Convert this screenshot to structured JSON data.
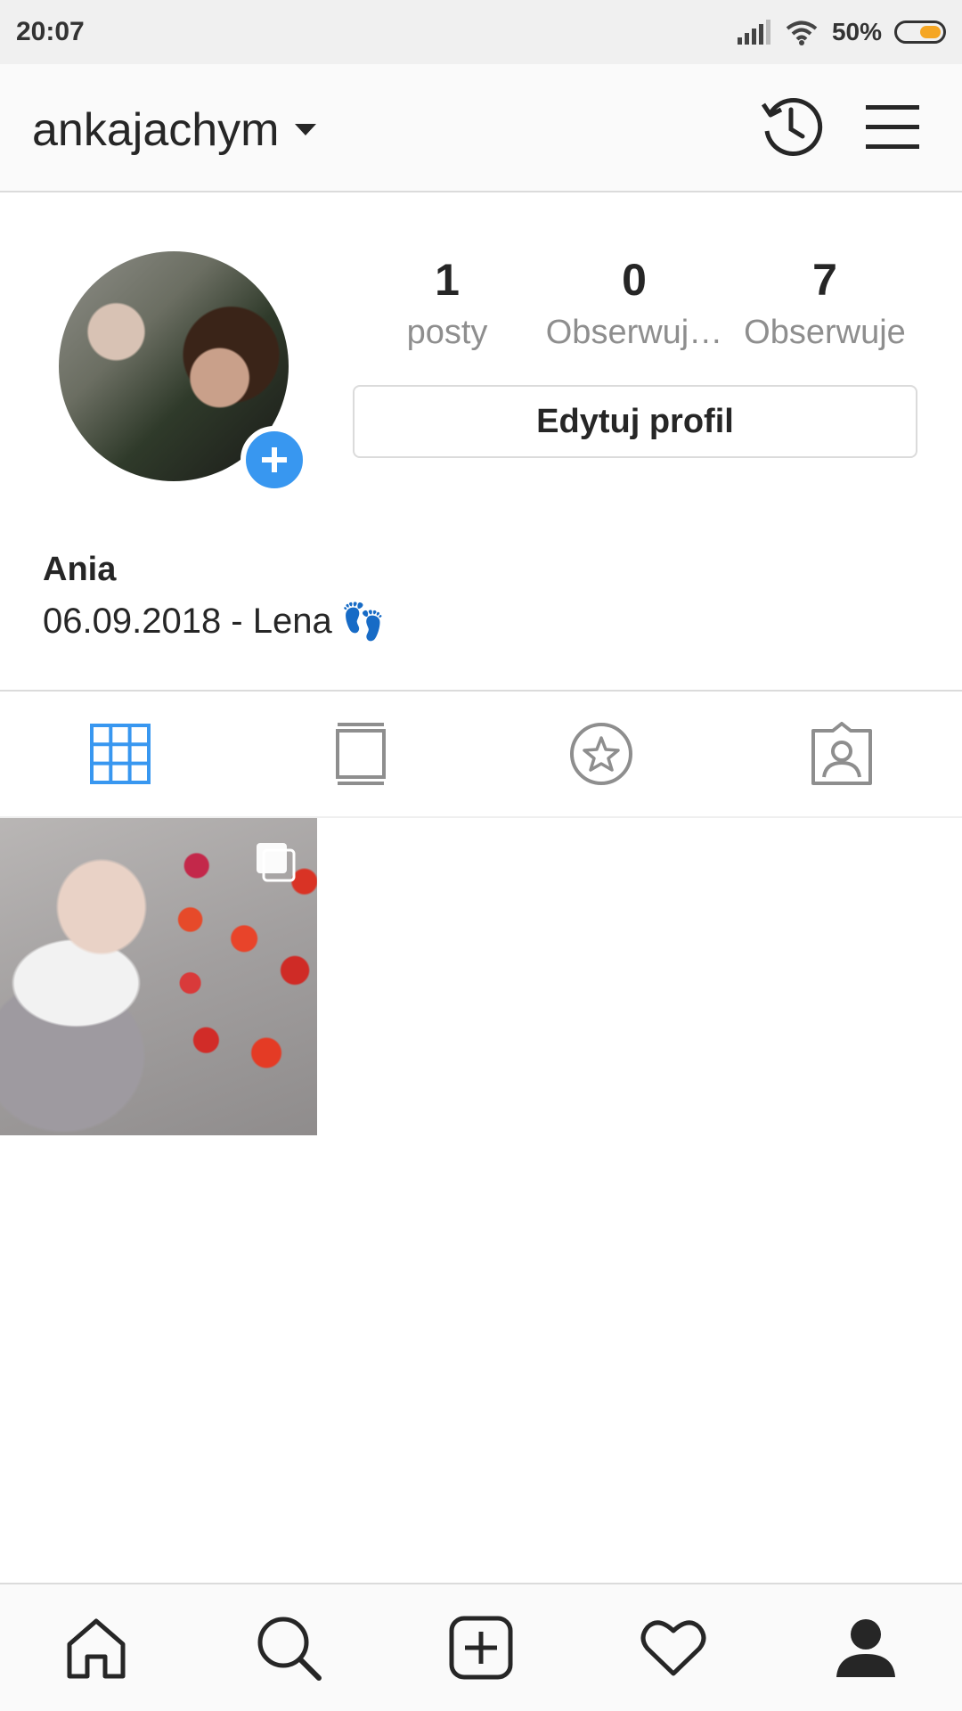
{
  "status_bar": {
    "time": "20:07",
    "battery": "50%",
    "battery_level": 0.5
  },
  "header": {
    "username": "ankajachym",
    "icons": [
      "chevron-down-icon",
      "archive-history-icon",
      "menu-icon"
    ]
  },
  "profile": {
    "stats": [
      {
        "value": "1",
        "label": "posty"
      },
      {
        "value": "0",
        "label": "Obserwuj…"
      },
      {
        "value": "7",
        "label": "Obserwuje"
      }
    ],
    "edit_button": "Edytuj profil",
    "name": "Ania",
    "bio": "06.09.2018 - Lena",
    "bio_emoji": "👣"
  },
  "tabs": [
    "grid-icon",
    "igtv-icon",
    "saved-star-icon",
    "tagged-icon"
  ],
  "active_tab": "grid",
  "accent_color": "#3897f0",
  "posts_count_shown": 1,
  "bottom_nav": [
    "home-icon",
    "search-icon",
    "add-post-icon",
    "activity-heart-icon",
    "profile-icon"
  ]
}
